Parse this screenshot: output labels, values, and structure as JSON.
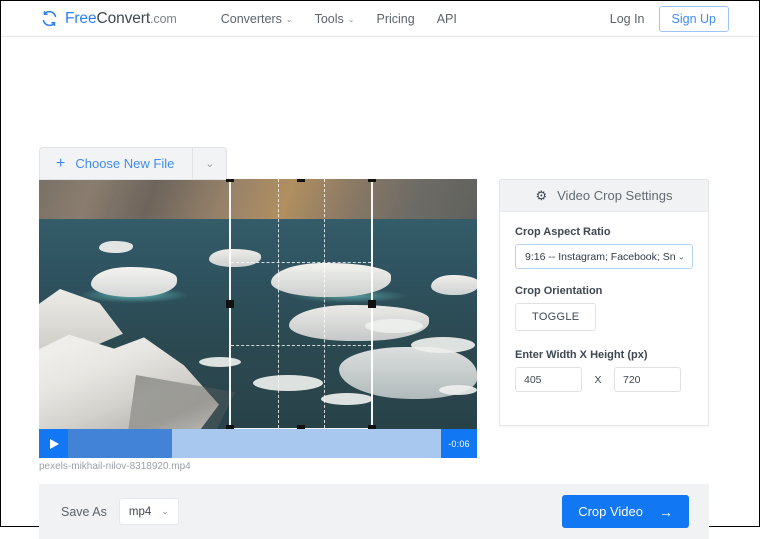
{
  "header": {
    "logo": {
      "icon": "refresh-circle-icon",
      "part1": "Free",
      "part2": "Convert",
      "part3": ".com"
    },
    "nav": [
      {
        "label": "Converters",
        "has_caret": true,
        "caret": "⌄"
      },
      {
        "label": "Tools",
        "has_caret": true,
        "caret": "⌄"
      },
      {
        "label": "Pricing",
        "has_caret": false
      },
      {
        "label": "API",
        "has_caret": false
      }
    ],
    "login_label": "Log In",
    "signup_label": "Sign Up"
  },
  "toolbar": {
    "choose_plus": "+",
    "choose_label": "Choose New File",
    "choose_caret": "⌄"
  },
  "player": {
    "play_icon": "play-icon",
    "time_remaining": "-0:06",
    "filename": "pexels-mikhail-nilov-8318920.mp4"
  },
  "settings": {
    "gear_icon": "⚙",
    "title": "Video Crop Settings",
    "aspect_label": "Crop Aspect Ratio",
    "aspect_value": "9:16 -- Instagram; Facebook; Sn",
    "aspect_caret": "⌄",
    "orientation_label": "Crop Orientation",
    "toggle_label": "TOGGLE",
    "size_label": "Enter Width X Height (px)",
    "width_value": "405",
    "x_separator": "X",
    "height_value": "720"
  },
  "savebar": {
    "save_as_label": "Save As",
    "format_value": "mp4",
    "format_caret": "⌄",
    "crop_button_label": "Crop Video",
    "crop_button_arrow": "→"
  },
  "colors": {
    "brand_blue": "#2d7ff9",
    "action_blue": "#1277f2",
    "link_blue": "#3f8cf4",
    "panel_gray": "#f1f2f3",
    "text_dark": "#3d4852",
    "text_muted": "#5b636b"
  }
}
